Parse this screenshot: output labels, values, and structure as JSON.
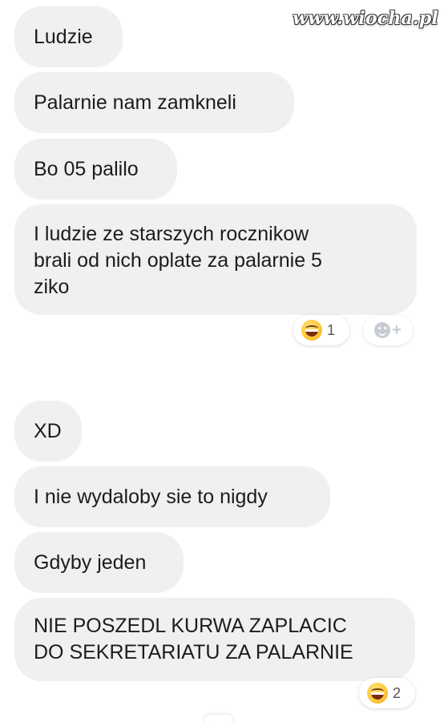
{
  "watermark": "www.wiocha.pl",
  "messages": [
    {
      "text": "Ludzie"
    },
    {
      "text": "Palarnie nam zamkneli"
    },
    {
      "text": "Bo 05 palilo"
    },
    {
      "lines": [
        "I ludzie ze starszych rocznikow",
        "brali od nich oplate za palarnie 5",
        "ziko"
      ]
    },
    {
      "text": "XD"
    },
    {
      "text": "I nie wydaloby sie to nigdy"
    },
    {
      "text": "Gdyby jeden"
    },
    {
      "lines": [
        "NIE POSZEDL KURWA ZAPLACIC",
        "DO SEKRETARIATU ZA PALARNIE"
      ]
    }
  ],
  "reactions": {
    "first": {
      "emoji": "laughing-face",
      "count": "1"
    },
    "add": {
      "icon": "add-reaction-icon",
      "plus": "+"
    },
    "second": {
      "emoji": "laughing-face",
      "count": "2"
    }
  },
  "colors": {
    "bubble": "#f0f0f0",
    "text": "#1c1c1c",
    "background": "#ffffff"
  }
}
